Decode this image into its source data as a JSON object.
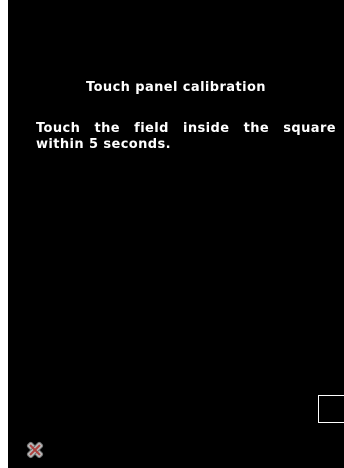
{
  "screen": {
    "title": "Touch panel calibration",
    "instructions": "Touch the field inside the square within 5 seconds."
  },
  "icons": {
    "close": "close-x-icon"
  },
  "colors": {
    "background": "#000000",
    "text": "#ffffff",
    "close_fill": "#b8b8b8",
    "close_accent": "#b0413e"
  }
}
